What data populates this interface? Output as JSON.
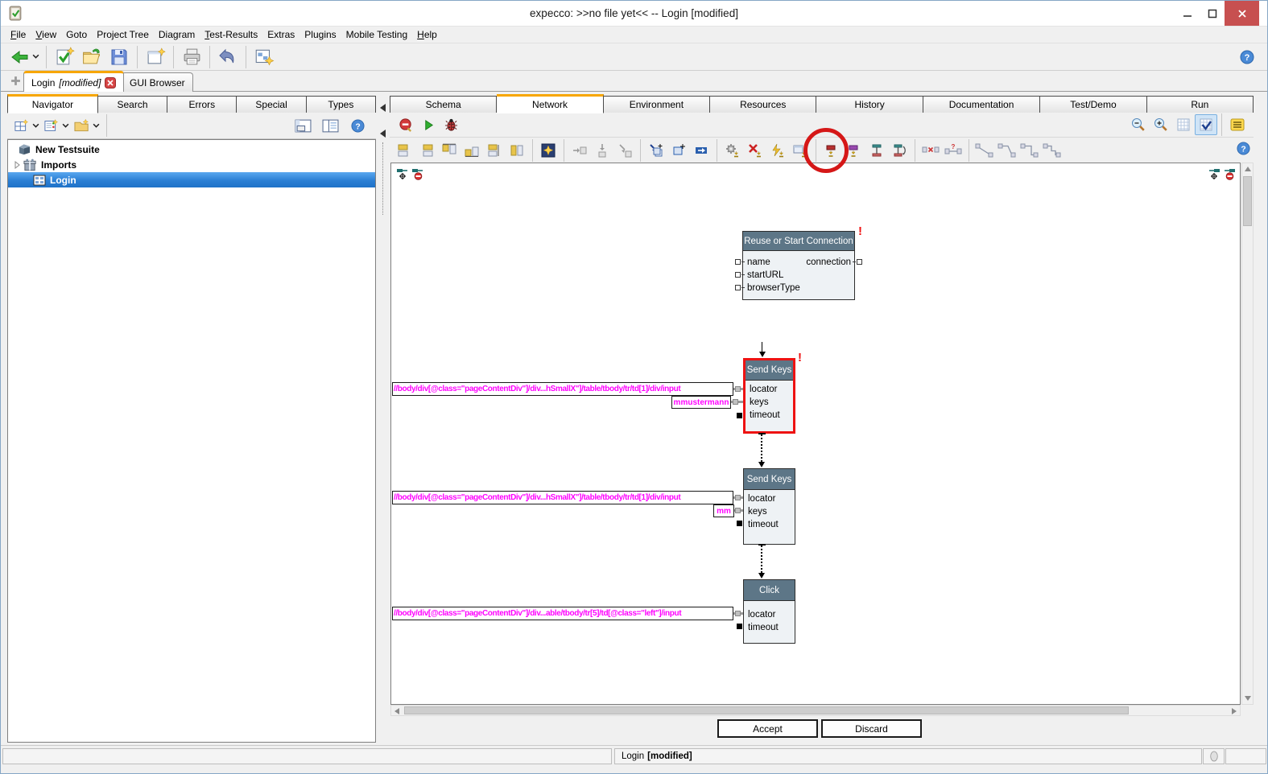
{
  "window": {
    "title": "expecco: >>no file yet<< -- Login [modified]"
  },
  "menubar": {
    "items": [
      "File",
      "View",
      "Goto",
      "Project Tree",
      "Diagram",
      "Test-Results",
      "Extras",
      "Plugins",
      "Mobile Testing",
      "Help"
    ]
  },
  "doc_tabs": {
    "tab1_label": "Login",
    "tab1_suffix": "[modified]",
    "tab2_label": "GUI Browser"
  },
  "left_panel": {
    "tabs": [
      "Navigator",
      "Search",
      "Errors",
      "Special",
      "Types"
    ],
    "tree": {
      "item1": "New Testsuite",
      "item2": "Imports",
      "item3": "Login"
    }
  },
  "right_panel": {
    "tabs": [
      "Schema",
      "Network",
      "Environment",
      "Resources",
      "History",
      "Documentation",
      "Test/Demo",
      "Run"
    ],
    "active_tab": "Network"
  },
  "diagram": {
    "block_reuse": {
      "title": "Reuse or Start Connection",
      "in1": "name",
      "in2": "startURL",
      "in3": "browserType",
      "out1": "connection",
      "error": "!"
    },
    "block_sendkeys1": {
      "title": "Send Keys",
      "in1": "locator",
      "in2": "keys",
      "in3": "timeout",
      "error": "!",
      "locator_value": "//body/div[@class=\"pageContentDiv\"]/div...hSmallX\"]/table/tbody/tr/td[1]/div/input",
      "keys_value": "mmustermann"
    },
    "block_sendkeys2": {
      "title": "Send Keys",
      "in1": "locator",
      "in2": "keys",
      "in3": "timeout",
      "locator_value": "//body/div[@class=\"pageContentDiv\"]/div...hSmallX\"]/table/tbody/tr/td[1]/div/input",
      "keys_value": "mm"
    },
    "block_click": {
      "title": "Click",
      "in1": "locator",
      "in2": "timeout",
      "locator_value": "//body/div[@class=\"pageContentDiv\"]/div...able/tbody/tr[5]/td[@class=\"left\"]/input"
    }
  },
  "footer": {
    "accept_label": "Accept",
    "discard_label": "Discard"
  },
  "statusbar": {
    "doc_name": "Login",
    "doc_state": "[modified]"
  },
  "icons": {
    "app-logo": "clipboard-check",
    "back-icon": "green-left-arrow",
    "new-testsuite-icon": "document-check-star",
    "open-icon": "folder-import",
    "save-icon": "floppy-disk",
    "new-window-icon": "window-star",
    "print-icon": "printer",
    "undo-icon": "curved-left-arrow",
    "tools-icon": "window-blocks-star",
    "help-icon": "blue-question-circle",
    "run-icon": "green-play-triangle",
    "debug-icon": "ladybug",
    "remove-breakpoints-icon": "red-ball",
    "zoom-out-icon": "magnifier-minus",
    "zoom-in-icon": "magnifier-plus",
    "grid-icon": "grid",
    "grid-snap-icon": "grid-check",
    "notes-icon": "yellow-list",
    "close-tab-icon": "red-x-box",
    "annotation": "red-circle-highlight"
  },
  "colors": {
    "tab_accent_orange": "#f7a600",
    "selection_blue": "#2b7fd4",
    "block_header": "#5d7687",
    "xpath_magenta": "#ff00ff",
    "error_red": "#ee1111",
    "selected_block_red": "#ee1212",
    "annotation_red": "#d51717",
    "close_button_red": "#c75050"
  }
}
